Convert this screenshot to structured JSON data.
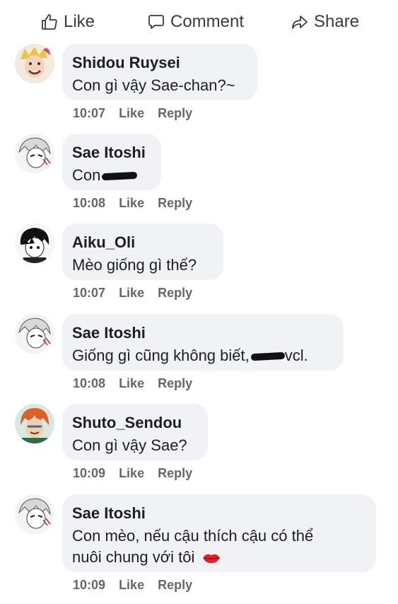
{
  "actions": {
    "like": "Like",
    "comment": "Comment",
    "share": "Share"
  },
  "comments": [
    {
      "author": "Shidou Ruysei",
      "text": "Con gì vậy Sae-chan?~",
      "time": "10:07",
      "like": "Like",
      "reply": "Reply"
    },
    {
      "author": "Sae Itoshi",
      "text": "Con",
      "redacted": true,
      "time": "10:08",
      "like": "Like",
      "reply": "Reply"
    },
    {
      "author": "Aiku_Oli",
      "text": "Mèo giống gì thế?",
      "time": "10:07",
      "like": "Like",
      "reply": "Reply"
    },
    {
      "author": "Sae Itoshi",
      "text_before": "Giống gì cũng không biết,",
      "text_after": "vcl.",
      "redacted": true,
      "time": "10:08",
      "like": "Like",
      "reply": "Reply"
    },
    {
      "author": "Shuto_Sendou",
      "text": "Con gì vậy Sae?",
      "time": "10:09",
      "like": "Like",
      "reply": "Reply"
    },
    {
      "author": "Sae Itoshi",
      "text_line1": "Con mèo, nếu cậu thích cậu có thể",
      "text_line2": "nuôi chung với tôi",
      "emoji": "kiss-lips-icon",
      "time": "10:09",
      "like": "Like",
      "reply": "Reply"
    }
  ]
}
